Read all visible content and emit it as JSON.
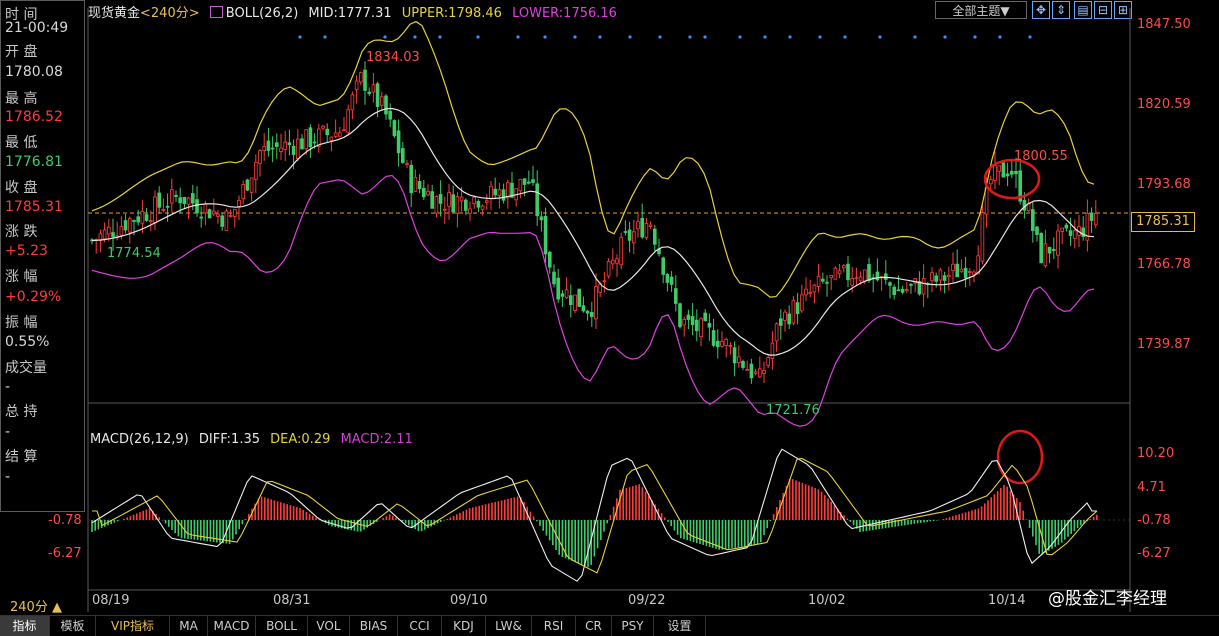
{
  "header": {
    "symbol": "现货黄金",
    "period": "<240分>",
    "indicator": "BOLL(26,2)",
    "mid": "MID:1777.31",
    "upper": "UPPER:1798.46",
    "lower": "LOWER:1756.16",
    "theme": "全部主题▼"
  },
  "info_panel": {
    "time_label": "时 间",
    "time_value": "21-00:49",
    "open_label": "开 盘",
    "open_value": "1780.08",
    "high_label": "最 高",
    "high_value": "1786.52",
    "low_label": "最 低",
    "low_value": "1776.81",
    "close_label": "收 盘",
    "close_value": "1785.31",
    "change_label": "涨 跌",
    "change_value": "+5.23",
    "pct_label": "涨 幅",
    "pct_value": "+0.29%",
    "amp_label": "振 幅",
    "amp_value": "0.55%",
    "vol_label": "成交量",
    "vol_value": "-",
    "oi_label": "总 持",
    "oi_value": "-",
    "settle_label": "结 算",
    "settle_value": "-"
  },
  "price_axis": [
    "1847.50",
    "1820.59",
    "1793.68",
    "1766.78",
    "1739.87"
  ],
  "last_price": "1785.31",
  "annotations": {
    "high": "1834.03",
    "low_left": "1774.54",
    "low_bottom": "1721.76",
    "recent_high": "1800.55"
  },
  "macd_header": {
    "name": "MACD(26,12,9)",
    "diff": "DIFF:1.35",
    "dea": "DEA:0.29",
    "macd": "MACD:2.11"
  },
  "macd_axis": [
    "10.20",
    "4.71",
    "-0.78",
    "-6.27"
  ],
  "macd_left_axis": [
    "-0.78",
    "-6.27"
  ],
  "date_axis": [
    "08/19",
    "08/31",
    "09/10",
    "09/22",
    "10/02",
    "10/14"
  ],
  "period_selector": "240分 ▲",
  "tabs": [
    "指标",
    "模板",
    "VIP指标",
    "MA",
    "MACD",
    "BOLL",
    "VOL",
    "BIAS",
    "CCI",
    "KDJ",
    "LW&",
    "RSI",
    "CR",
    "PSY",
    "设置"
  ],
  "watermark": "@股金汇李经理",
  "colors": {
    "up": "#ff3c3c",
    "down": "#3ecb68",
    "upper_band": "#e6d23c",
    "mid_band": "#e8e8e8",
    "lower_band": "#e040e0",
    "dea": "#e6d23c",
    "macd_text": "#d040d0"
  },
  "icons": [
    "arrow-cross-icon",
    "up-down-icon",
    "chart-icon",
    "split-icon",
    "add-window-icon"
  ]
}
